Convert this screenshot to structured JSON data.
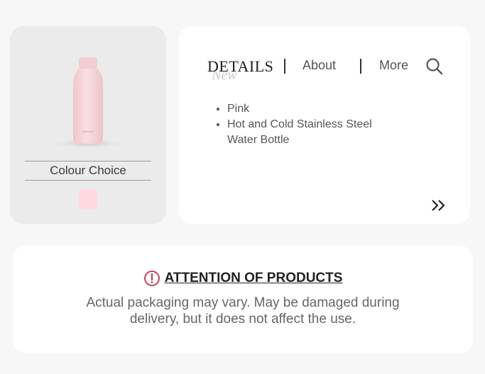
{
  "product": {
    "colour_label": "Colour Choice",
    "swatch_color": "#ffd9df",
    "bottle_color": "#f7d7da"
  },
  "details": {
    "tabs": {
      "details": "DETAILS",
      "new": "New",
      "about": "About",
      "more": "More"
    },
    "features": [
      "Pink",
      "Hot and Cold Stainless Steel Water Bottle"
    ],
    "search_icon": "search-icon",
    "next_icon": "double-chevron-right-icon"
  },
  "attention": {
    "title": "ATTENTION OF PRODUCTS",
    "body": "Actual packaging may vary. May be damaged during delivery, but it does not affect the use.",
    "accent": "#c0485a"
  }
}
